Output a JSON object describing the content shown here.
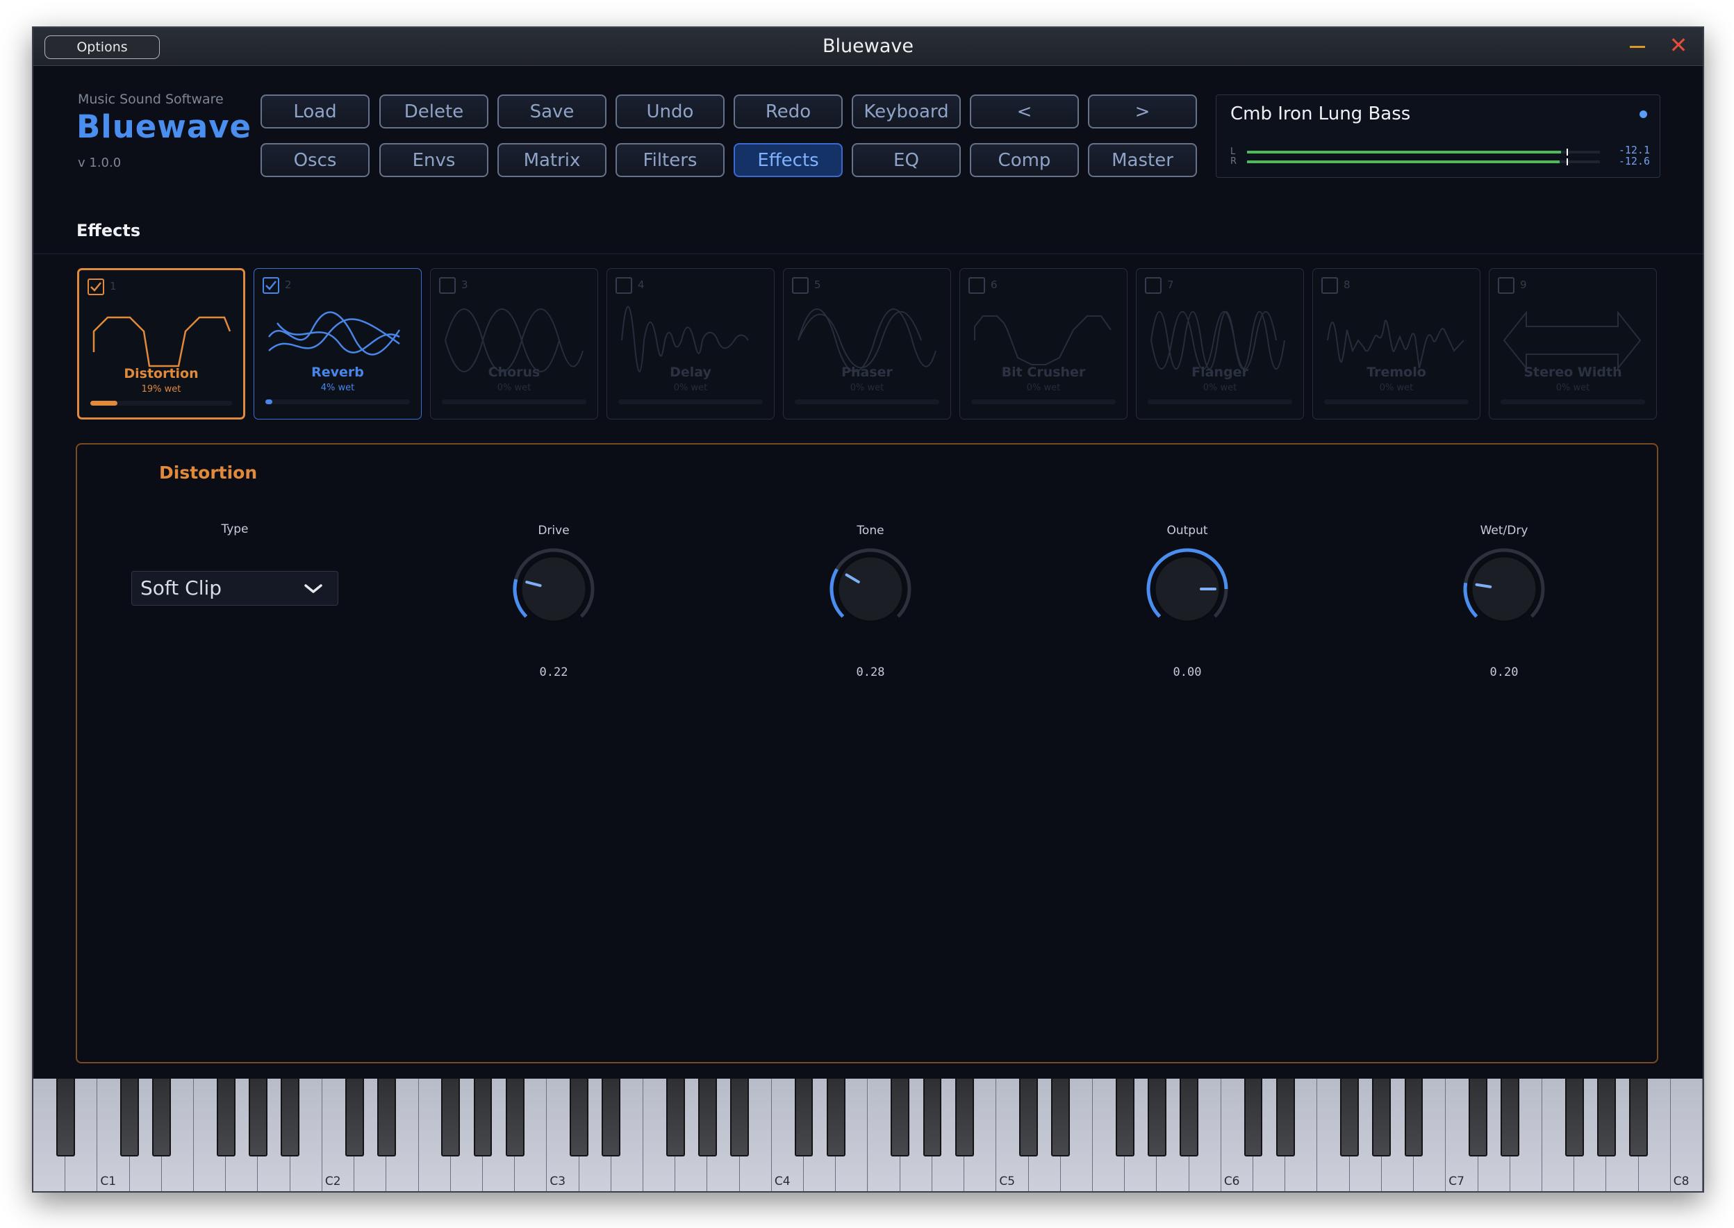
{
  "window": {
    "title": "Bluewave",
    "options_label": "Options"
  },
  "brand": {
    "company": "Music Sound Software",
    "logo": "Bluewave",
    "version": "v 1.0.0"
  },
  "toolbar": {
    "row1": [
      "Load",
      "Delete",
      "Save",
      "Undo",
      "Redo",
      "Keyboard",
      "<",
      ">"
    ],
    "row2": [
      "Oscs",
      "Envs",
      "Matrix",
      "Filters",
      "Effects",
      "EQ",
      "Comp",
      "Master"
    ],
    "active_tab": "Effects"
  },
  "preset": {
    "name": "Cmb Iron Lung Bass",
    "meters": [
      {
        "channel": "L",
        "value": "-12.1",
        "level": 0.89
      },
      {
        "channel": "R",
        "value": "-12.6",
        "level": 0.885
      }
    ]
  },
  "section": {
    "title": "Effects"
  },
  "effects": [
    {
      "num": "1",
      "name": "Distortion",
      "wet": "19% wet",
      "enabled": true,
      "selected": true,
      "wet_level": 0.19,
      "accent": "#e08a3c"
    },
    {
      "num": "2",
      "name": "Reverb",
      "wet": "4% wet",
      "enabled": true,
      "selected": false,
      "wet_level": 0.04,
      "accent": "#4a86e8"
    },
    {
      "num": "3",
      "name": "Chorus",
      "wet": "0% wet",
      "enabled": false,
      "selected": false,
      "wet_level": 0
    },
    {
      "num": "4",
      "name": "Delay",
      "wet": "0% wet",
      "enabled": false,
      "selected": false,
      "wet_level": 0
    },
    {
      "num": "5",
      "name": "Phaser",
      "wet": "0% wet",
      "enabled": false,
      "selected": false,
      "wet_level": 0
    },
    {
      "num": "6",
      "name": "Bit Crusher",
      "wet": "0% wet",
      "enabled": false,
      "selected": false,
      "wet_level": 0
    },
    {
      "num": "7",
      "name": "Flanger",
      "wet": "0% wet",
      "enabled": false,
      "selected": false,
      "wet_level": 0
    },
    {
      "num": "8",
      "name": "Tremolo",
      "wet": "0% wet",
      "enabled": false,
      "selected": false,
      "wet_level": 0
    },
    {
      "num": "9",
      "name": "Stereo Width",
      "wet": "0% wet",
      "enabled": false,
      "selected": false,
      "wet_level": 0
    }
  ],
  "distortion": {
    "title": "Distortion",
    "type_label": "Type",
    "type_value": "Soft Clip",
    "knobs": [
      {
        "label": "Drive",
        "value": "0.22",
        "level": 0.22
      },
      {
        "label": "Tone",
        "value": "0.28",
        "level": 0.28
      },
      {
        "label": "Output",
        "value": "0.00",
        "level": 0.5
      },
      {
        "label": "Wet/Dry",
        "value": "0.20",
        "level": 0.2
      }
    ]
  },
  "keyboard": {
    "octave_labels": [
      "C1",
      "C2",
      "C3",
      "C4",
      "C5",
      "C6",
      "C7",
      "C8"
    ]
  },
  "colors": {
    "accent_blue": "#4a8ff0",
    "accent_orange": "#e08a3c",
    "background": "#0b0e17"
  }
}
